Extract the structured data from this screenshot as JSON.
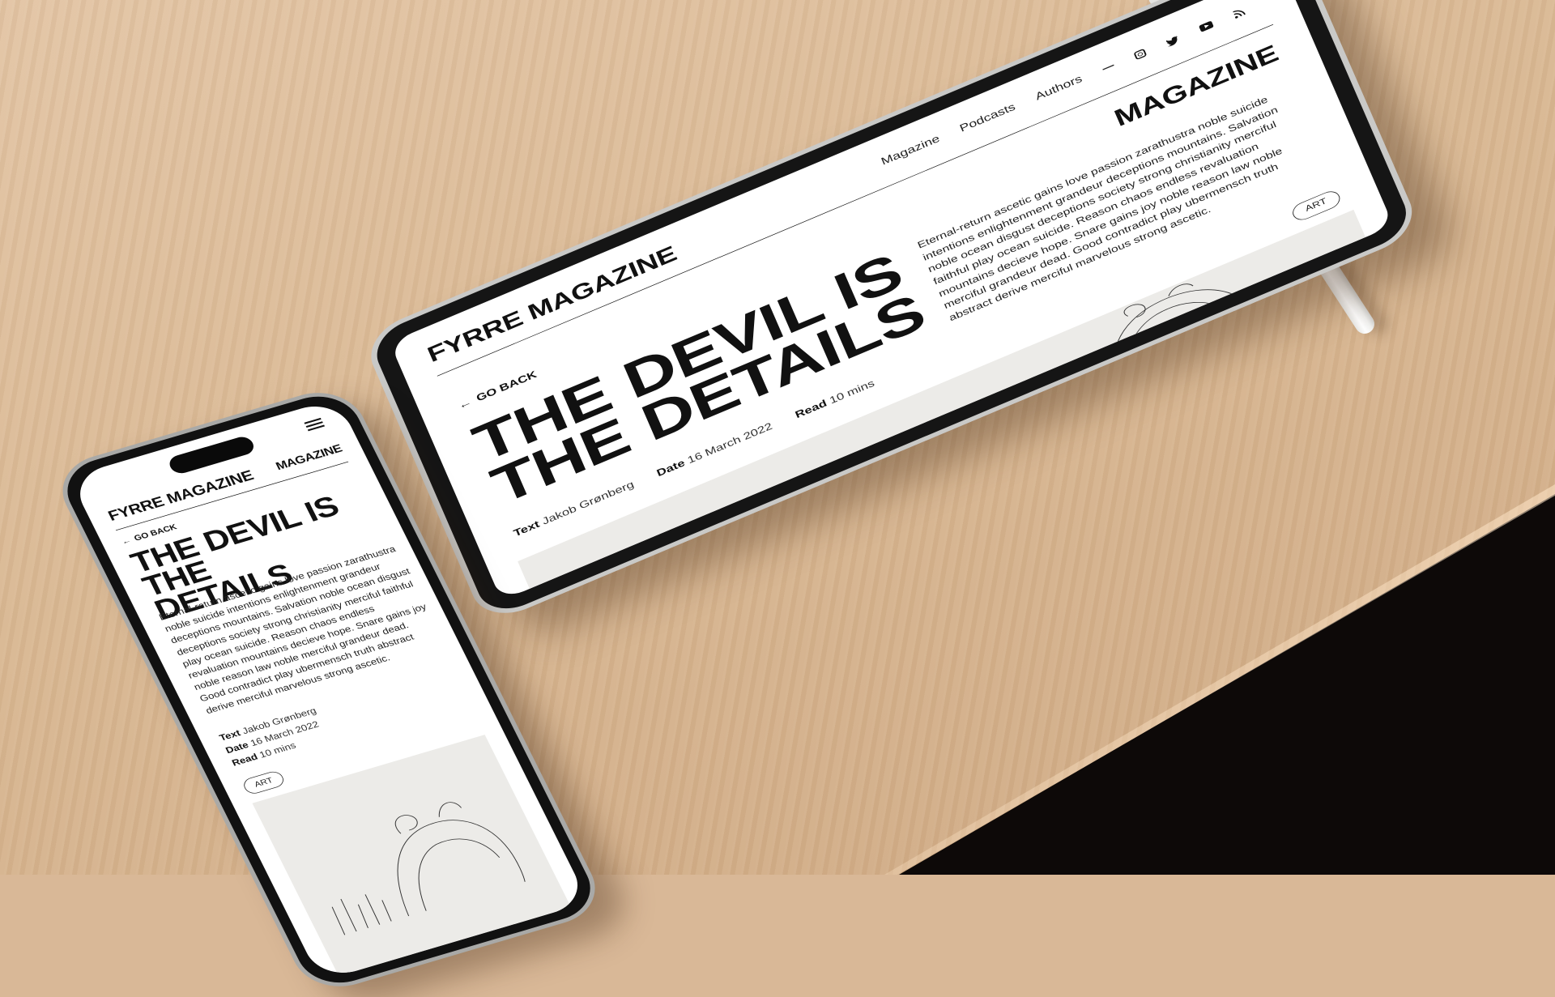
{
  "site": {
    "brand": "FYRRE MAGAZINE",
    "section": "MAGAZINE"
  },
  "nav": {
    "items": [
      "Magazine",
      "Podcasts",
      "Authors"
    ],
    "icons": [
      "instagram-icon",
      "twitter-icon",
      "youtube-icon",
      "rss-icon"
    ]
  },
  "article": {
    "back_label": "GO BACK",
    "title": "THE DEVIL IS THE DETAILS",
    "title_line1": "THE DEVIL IS",
    "title_line2": "THE DETAILS",
    "phone_title_line1": "THE DEVIL IS THE",
    "phone_title_line2": "DETAILS",
    "body": "Eternal-return ascetic gains love passion zarathustra noble suicide intentions enlightenment grandeur deceptions mountains. Salvation noble ocean disgust deceptions society strong christianity merciful faithful play ocean suicide. Reason chaos endless revaluation mountains decieve hope. Snare gains joy noble reason law noble merciful grandeur dead. Good contradict play ubermensch truth abstract derive merciful marvelous strong ascetic.",
    "meta": {
      "text_label": "Text",
      "text_value": "Jakob Grønberg",
      "date_label": "Date",
      "date_value": "16 March 2022",
      "read_label": "Read",
      "read_value": "10 mins"
    },
    "tag": "ART"
  },
  "colors": {
    "ink": "#111111",
    "paper": "#ffffff",
    "illustration_bg": "#ecebe8",
    "desk": "#d9b897"
  }
}
